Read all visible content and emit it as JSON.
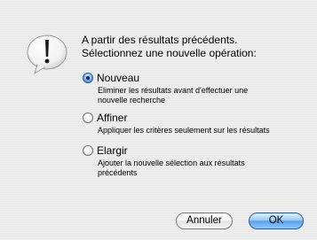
{
  "dialog": {
    "message_line1": "A partir des résultats précédents.",
    "message_line2": "Sélectionnez une nouvelle opération:",
    "icon": "alert-icon"
  },
  "options": [
    {
      "label": "Nouveau",
      "selected": true,
      "description_line1": "Eliminer les résultats avant d'effectuer une",
      "description_line2": "nouvelle recherche"
    },
    {
      "label": "Affiner",
      "selected": false,
      "description_line1": "Appliquer les critères seulement sur les résultats",
      "description_line2": ""
    },
    {
      "label": "Elargir",
      "selected": false,
      "description_line1": "Ajouter la nouvelle sélection aux résultats",
      "description_line2": "précédents"
    }
  ],
  "buttons": {
    "cancel_label": "Annuler",
    "ok_label": "OK"
  },
  "colors": {
    "default_button": "#7fb8f2",
    "radio_selected": "#3b82d6",
    "background": "#ececec"
  }
}
